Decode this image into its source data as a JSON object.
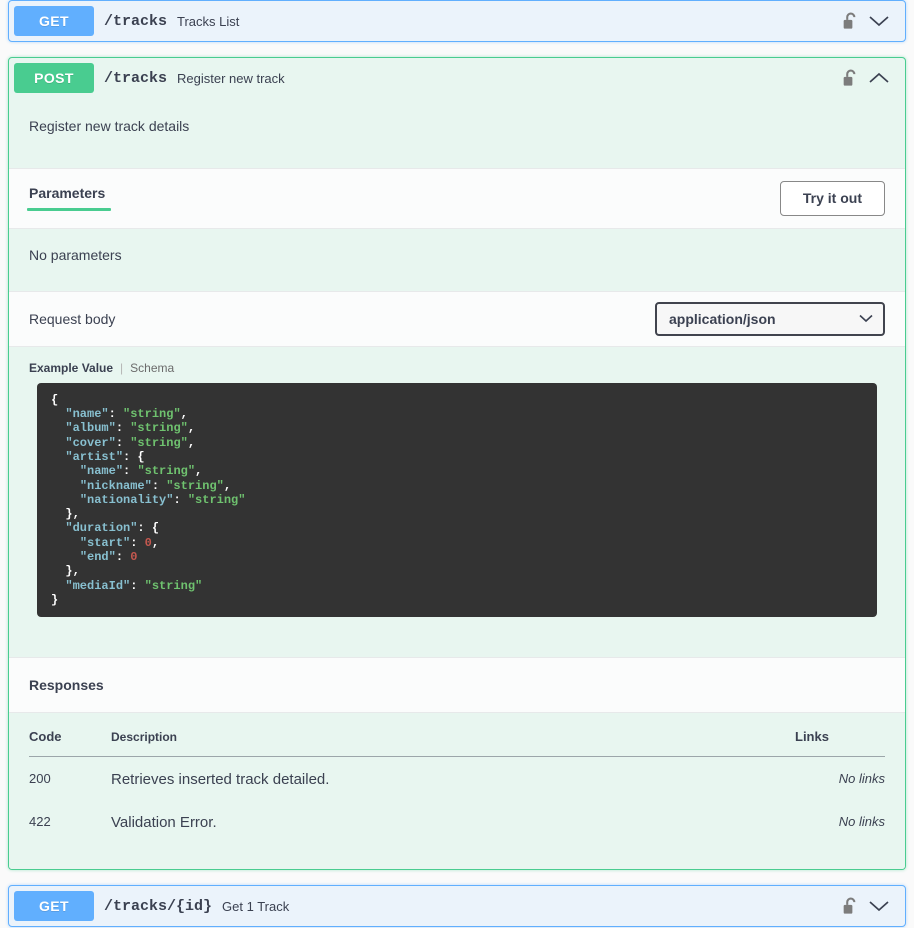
{
  "operations": [
    {
      "method": "GET",
      "path": "/tracks",
      "summary": "Tracks List",
      "expanded": false,
      "lock": "unlocked-padlock-icon",
      "chevron": "chevron-down-icon"
    },
    {
      "method": "POST",
      "path": "/tracks",
      "summary": "Register new track",
      "expanded": true,
      "lock": "unlocked-padlock-icon",
      "chevron": "chevron-up-icon",
      "description": "Register new track details",
      "parameters": {
        "tab_label": "Parameters",
        "try_it_out_label": "Try it out",
        "empty_text": "No parameters"
      },
      "request_body": {
        "label": "Request body",
        "content_type": "application/json",
        "content_type_options": [
          "application/json"
        ],
        "example_tab": "Example Value",
        "schema_tab": "Schema",
        "example_json": "{\n  \"name\": \"string\",\n  \"album\": \"string\",\n  \"cover\": \"string\",\n  \"artist\": {\n    \"name\": \"string\",\n    \"nickname\": \"string\",\n    \"nationality\": \"string\"\n  },\n  \"duration\": {\n    \"start\": 0,\n    \"end\": 0\n  },\n  \"mediaId\": \"string\"\n}"
      },
      "responses": {
        "title": "Responses",
        "columns": {
          "code": "Code",
          "description": "Description",
          "links": "Links"
        },
        "rows": [
          {
            "code": "200",
            "description": "Retrieves inserted track detailed.",
            "links": "No links"
          },
          {
            "code": "422",
            "description": "Validation Error.",
            "links": "No links"
          }
        ]
      }
    },
    {
      "method": "GET",
      "path": "/tracks/{id}",
      "summary": "Get 1 Track",
      "expanded": false,
      "lock": "unlocked-padlock-icon",
      "chevron": "chevron-down-icon"
    }
  ],
  "colors": {
    "get_accent": "#61affe",
    "post_accent": "#49cc90",
    "get_bg": "#ebf3fb",
    "post_bg": "#e8f6f0",
    "code_bg": "#333333",
    "text": "#3b4151"
  }
}
